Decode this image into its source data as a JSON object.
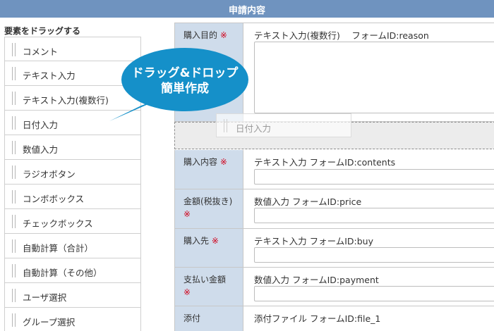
{
  "header": {
    "title": "申請内容"
  },
  "palette": {
    "heading": "要素をドラッグする",
    "items": [
      "コメント",
      "テキスト入力",
      "テキスト入力(複数行)",
      "日付入力",
      "数値入力",
      "ラジオボタン",
      "コンボボックス",
      "チェックボックス",
      "自動計算（合計）",
      "自動計算（その他）",
      "ユーザ選択",
      "グループ選択"
    ]
  },
  "callout": {
    "line1": "ドラッグ&ドロップ",
    "line2": "簡単作成"
  },
  "dragging": {
    "label": "日付入力"
  },
  "form": {
    "required_mark": "※",
    "rows": [
      {
        "label": "購入目的",
        "required": true,
        "desc": "テキスト入力(複数行)　 フォームID:reason"
      },
      {
        "label": "購入内容",
        "required": true,
        "desc": "テキスト入力 フォームID:contents"
      },
      {
        "label": "金額(税抜き)",
        "required": true,
        "desc": "数値入力 フォームID:price"
      },
      {
        "label": "購入先",
        "required": true,
        "desc": "テキスト入力 フォームID:buy"
      },
      {
        "label": "支払い金額",
        "required": true,
        "desc": "数値入力 フォームID:payment"
      },
      {
        "label": "添付",
        "required": false,
        "desc": "添付ファイル フォームID:file_1"
      }
    ]
  },
  "colors": {
    "header_bg": "#6f93bf",
    "label_cell_bg": "#cfdceb",
    "callout_bg": "#1590c9",
    "required": "#d0021b"
  }
}
